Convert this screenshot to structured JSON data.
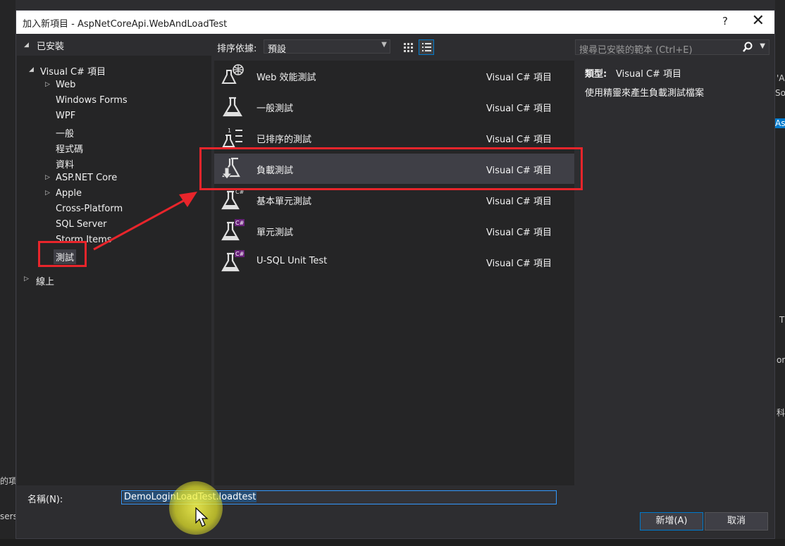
{
  "background": {
    "fragments": [
      "'A",
      "So",
      "Asp",
      "T",
      "on",
      "科",
      "的項目",
      "sers"
    ]
  },
  "dialog": {
    "title": "加入新項目 - AspNetCoreApi.WebAndLoadTest",
    "help_label": "?",
    "close_label": "✕"
  },
  "tree": {
    "installed_label": "已安裝",
    "visual_csharp_label": "Visual C# 項目",
    "items": [
      "Web",
      "Windows Forms",
      "WPF",
      "一般",
      "程式碼",
      "資料",
      "ASP.NET Core",
      "Apple",
      "Cross-Platform",
      "SQL Server",
      "Storm Items",
      "測試"
    ],
    "online_label": "線上",
    "selected_item": "測試"
  },
  "toolbar": {
    "sort_label": "排序依據:",
    "sort_value": "預設"
  },
  "search": {
    "placeholder": "搜尋已安裝的範本 (Ctrl+E)"
  },
  "templates": [
    {
      "name": "Web 效能測試",
      "lang": "Visual C# 項目",
      "icon": "web-performance-test-icon"
    },
    {
      "name": "一般測試",
      "lang": "Visual C# 項目",
      "icon": "generic-test-icon"
    },
    {
      "name": "已排序的測試",
      "lang": "Visual C# 項目",
      "icon": "ordered-test-icon"
    },
    {
      "name": "負載測試",
      "lang": "Visual C# 項目",
      "icon": "load-test-icon"
    },
    {
      "name": "基本單元測試",
      "lang": "Visual C# 項目",
      "icon": "basic-unit-test-icon"
    },
    {
      "name": "單元測試",
      "lang": "Visual C# 項目",
      "icon": "unit-test-icon"
    },
    {
      "name": "U-SQL Unit Test",
      "lang": "Visual C# 項目",
      "icon": "usql-unit-test-icon"
    }
  ],
  "selected_template": "負載測試",
  "detail": {
    "type_label": "類型:",
    "type_value": "Visual C# 項目",
    "description": "使用精靈來產生負載測試檔案"
  },
  "name_field": {
    "label": "名稱(N):",
    "value": "DemoLoginLoadTest.loadtest"
  },
  "buttons": {
    "ok_label": "新增(A)",
    "cancel_label": "取消"
  },
  "colors": {
    "accent": "#007acc",
    "highlight_red": "#e8252b",
    "cursor_glow": "#ebeb28"
  }
}
